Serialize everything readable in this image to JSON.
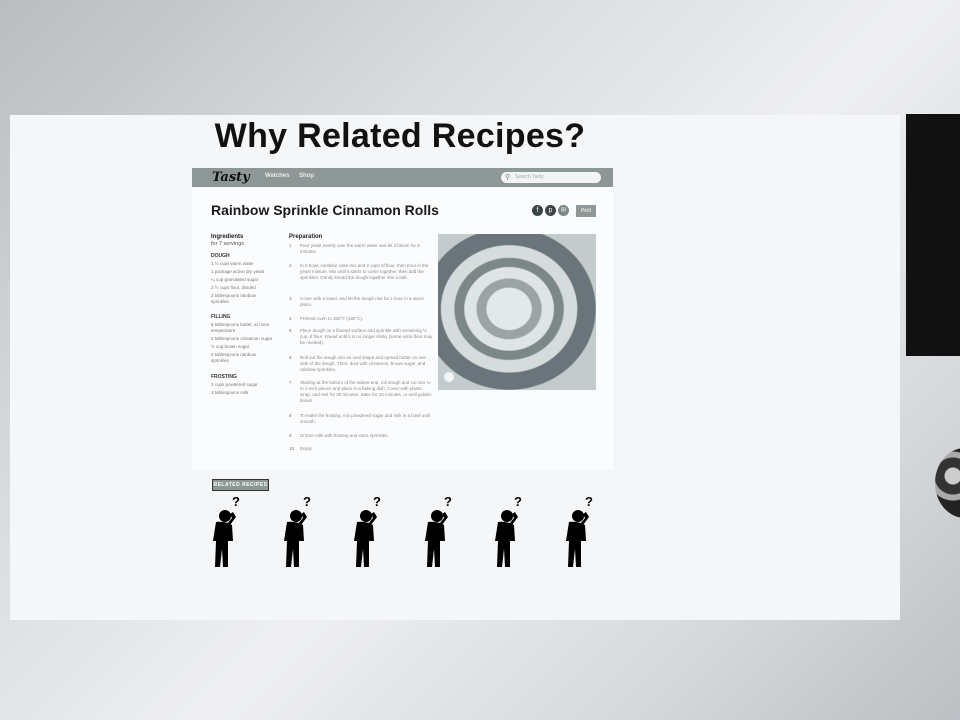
{
  "slide": {
    "title": "Why Related Recipes?"
  },
  "site": {
    "logo": "Tasty",
    "nav": [
      "Watches",
      "Shop"
    ],
    "search_placeholder": "Search Tasty"
  },
  "recipe": {
    "title": "Rainbow Sprinkle Cinnamon Rolls",
    "pin_label": "PinIt",
    "ingredients_heading": "Ingredients",
    "servings": "for 7 servings",
    "sections": [
      {
        "name": "DOUGH",
        "items": [
          "1 ½ cups warm water",
          "1 package active dry yeast",
          "¼ cup granulated sugar",
          "2 ½ cups flour, divided",
          "2 tablespoons rainbow sprinkles"
        ]
      },
      {
        "name": "FILLING",
        "items": [
          "6 tablespoons butter, at room temperature",
          "2 tablespoons cinnamon sugar",
          "½ cup brown sugar",
          "2 tablespoons rainbow sprinkles"
        ]
      },
      {
        "name": "FROSTING",
        "items": [
          "2 cups powdered sugar",
          "3 tablespoons milk"
        ]
      }
    ],
    "preparation_heading": "Preparation",
    "steps": [
      "Pour yeast evenly over the warm water and let it bloom for 5 minutes.",
      "In a bowl, combine cake mix and 2 cups of flour, then pour in the yeast mixture. Mix until it starts to come together, then add the sprinkles. Gently knead the dough together into a ball.",
      "Cover with a towel, and let the dough rise for 1 hour in a warm place.",
      "Preheat oven to 350°F (180°C).",
      "Place dough on a floured surface and sprinkle with remaining ½ cup of flour. Knead until it is no longer sticky (some extra flour may be needed).",
      "Roll out the dough into an oval shape and spread butter on one side of the dough. Then, dust with cinnamon, brown sugar, and rainbow sprinkles.",
      "Starting at the bottom of the widest end, roll dough and cut into ¾- to 1-inch pieces and place in a baking dish. Cover with plastic wrap, and rest for 30 minutes. Bake for 15 minutes, or until golden brown.",
      "To make the frosting, mix powdered sugar and milk in a bowl until smooth.",
      "Drizzle rolls with frosting and extra sprinkles.",
      "Enjoy!"
    ]
  },
  "related_button": "RELATED RECIPES",
  "related_count": 6,
  "colors": {
    "nav_bar": "#8d9795",
    "background": "#f4f6f8",
    "figure": "#000000"
  }
}
